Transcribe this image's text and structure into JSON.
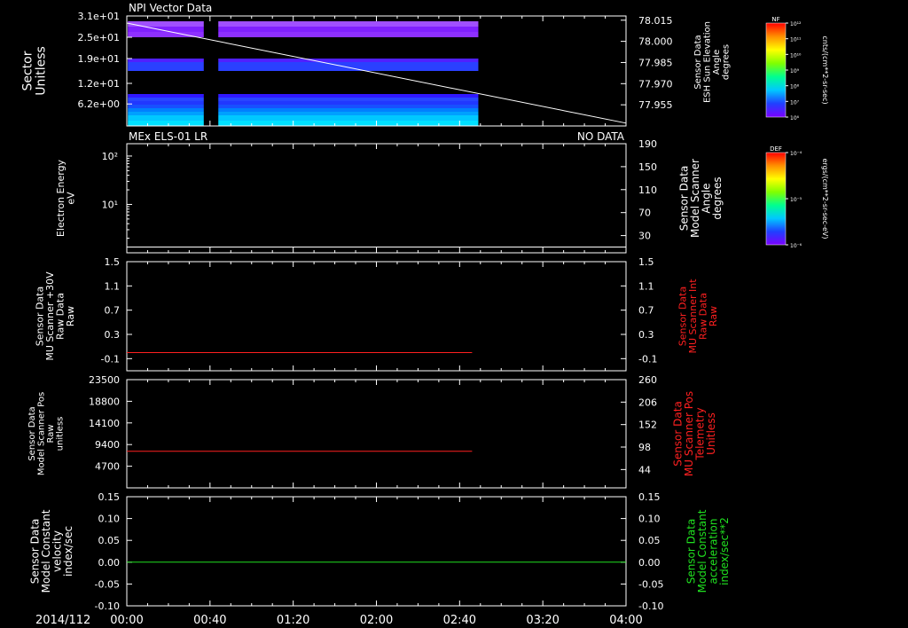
{
  "time_axis": {
    "date_label": "2014/112",
    "tick_labels": [
      "00:00",
      "00:40",
      "01:20",
      "02:00",
      "02:40",
      "03:20",
      "04:00"
    ],
    "minutes": [
      0,
      40,
      80,
      120,
      160,
      200,
      240
    ],
    "range_minutes": [
      0,
      240
    ]
  },
  "colors": {
    "background": "#000000",
    "axis": "#ffffff",
    "red_trace": "#ff2020",
    "green_trace": "#20e020"
  },
  "colorbars": [
    {
      "label": "NF",
      "unit": "cnts/(cm**2-sr-sec)",
      "tick_labels": [
        "10¹²",
        "10¹¹",
        "10¹⁰",
        "10⁹",
        "10⁸",
        "10⁷",
        "10⁶"
      ]
    },
    {
      "label": "DEF",
      "unit": "ergs/(cm**2-sr-sec-eV)",
      "tick_labels": [
        "10⁻⁴",
        "10⁻⁵",
        "10⁻⁶"
      ]
    }
  ],
  "chart_data": [
    {
      "type": "heatmap",
      "title": "NPI Vector Data",
      "ylabel": "Sector\nUnitless",
      "yticks": [
        "3.1e+01",
        "2.5e+01",
        "1.9e+01",
        "1.2e+01",
        "6.2e+00"
      ],
      "ylim": [
        0,
        31
      ],
      "y2label": "Sensor Data\nESH Sun Elevation\nAngle\ndegrees",
      "y2ticks": [
        "78.015",
        "78.000",
        "77.985",
        "77.970",
        "77.955"
      ],
      "y2values": [
        78.015,
        78.0,
        77.985,
        77.97,
        77.955
      ],
      "y2lim": [
        77.94,
        78.018
      ],
      "data_gaps_minutes": [
        [
          0,
          0.5
        ],
        [
          37,
          44
        ],
        [
          169,
          240
        ]
      ],
      "sectors": [
        {
          "range": [
            0,
            1.5
          ],
          "color": "#00e0ff"
        },
        {
          "range": [
            1.5,
            3
          ],
          "color": "#00c8ff"
        },
        {
          "range": [
            3,
            4
          ],
          "color": "#00a0ff"
        },
        {
          "range": [
            4,
            5
          ],
          "color": "#0080ff"
        },
        {
          "range": [
            5,
            6
          ],
          "color": "#1850ff"
        },
        {
          "range": [
            6,
            7
          ],
          "color": "#2038ff"
        },
        {
          "range": [
            7,
            8
          ],
          "color": "#2846ff"
        },
        {
          "range": [
            8,
            9
          ],
          "color": "#3018ff"
        },
        {
          "range": [
            15.5,
            18
          ],
          "color": "#2a40ff"
        },
        {
          "range": [
            18,
            19
          ],
          "color": "#5020ff"
        },
        {
          "range": [
            25,
            26.5
          ],
          "color": "#8e30ff"
        },
        {
          "range": [
            26.5,
            28
          ],
          "color": "#8020ff"
        },
        {
          "range": [
            28,
            29.5
          ],
          "color": "#a050ff"
        }
      ],
      "sun_elevation_line": {
        "x": [
          0,
          240
        ],
        "y": [
          78.013,
          77.942
        ]
      }
    },
    {
      "type": "line",
      "title": "MEx ELS-01 LR",
      "status": "NO DATA",
      "ylabel": "Electron Energy\neV",
      "yticks": [
        "10²",
        "10¹"
      ],
      "ytick_values": [
        100,
        10
      ],
      "ylim": [
        1,
        180
      ],
      "y2label": "Sensor Data\nModel Scanner\nAngle\ndegrees",
      "y2ticks": [
        "190",
        "150",
        "110",
        "70",
        "30"
      ],
      "y2values": [
        190,
        150,
        110,
        70,
        30
      ],
      "y2lim": [
        0,
        190
      ],
      "series": [
        {
          "axis": "y2",
          "color": "#ffffff",
          "x": [
            0,
            240
          ],
          "y": [
            10,
            10
          ]
        }
      ]
    },
    {
      "type": "line",
      "ylabel": "Sensor Data\nMU Scanner +30V\nRaw Data\nRaw",
      "yticks": [
        "1.5",
        "1.1",
        "0.7",
        "0.3",
        "-0.1"
      ],
      "yvalues": [
        1.5,
        1.1,
        0.7,
        0.3,
        -0.1
      ],
      "ylim": [
        -0.3,
        1.5
      ],
      "y2label": "Sensor Data\nMU Scanner Int\nRaw Data\nRaw",
      "y2ticks": [
        "1.5",
        "1.1",
        "0.7",
        "0.3",
        "-0.1"
      ],
      "y2values": [
        1.5,
        1.1,
        0.7,
        0.3,
        -0.1
      ],
      "y2lim": [
        -0.3,
        1.5
      ],
      "series": [
        {
          "axis": "y",
          "color": "#ff2020",
          "x": [
            0,
            166
          ],
          "y": [
            0.0,
            0.0
          ]
        }
      ]
    },
    {
      "type": "line",
      "ylabel": "Sensor Data\nModel Scanner Pos\nRaw\nunitless",
      "yticks": [
        "23500",
        "18800",
        "14100",
        "9400",
        "4700"
      ],
      "yvalues": [
        23500,
        18800,
        14100,
        9400,
        4700
      ],
      "ylim": [
        0,
        23500
      ],
      "y2label": "Sensor Data\nMU Scanner Pos\nTelemetry\nUnitless",
      "y2ticks": [
        "260",
        "206",
        "152",
        "98",
        "44"
      ],
      "y2values": [
        260,
        206,
        152,
        98,
        44
      ],
      "y2lim": [
        0,
        260
      ],
      "series": [
        {
          "axis": "y",
          "color": "#ff2020",
          "x": [
            0,
            166
          ],
          "y": [
            7950,
            7950
          ]
        }
      ]
    },
    {
      "type": "line",
      "ylabel": "Sensor Data\nModel Constant\nvelocity\nindex/sec",
      "yticks": [
        "0.15",
        "0.10",
        "0.05",
        "0.00",
        "-0.05",
        "-0.10"
      ],
      "yvalues": [
        0.15,
        0.1,
        0.05,
        0.0,
        -0.05,
        -0.1
      ],
      "ylim": [
        -0.1,
        0.15
      ],
      "y2label": "Sensor Data\nModel Constant\nacceleration\nindex/sec**2",
      "y2ticks": [
        "0.15",
        "0.10",
        "0.05",
        "0.00",
        "-0.05",
        "-0.10"
      ],
      "y2values": [
        0.15,
        0.1,
        0.05,
        0.0,
        -0.05,
        -0.1
      ],
      "y2lim": [
        -0.1,
        0.15
      ],
      "series": [
        {
          "axis": "y",
          "color": "#20e020",
          "x": [
            0,
            240
          ],
          "y": [
            0.0,
            0.0
          ]
        }
      ]
    }
  ]
}
